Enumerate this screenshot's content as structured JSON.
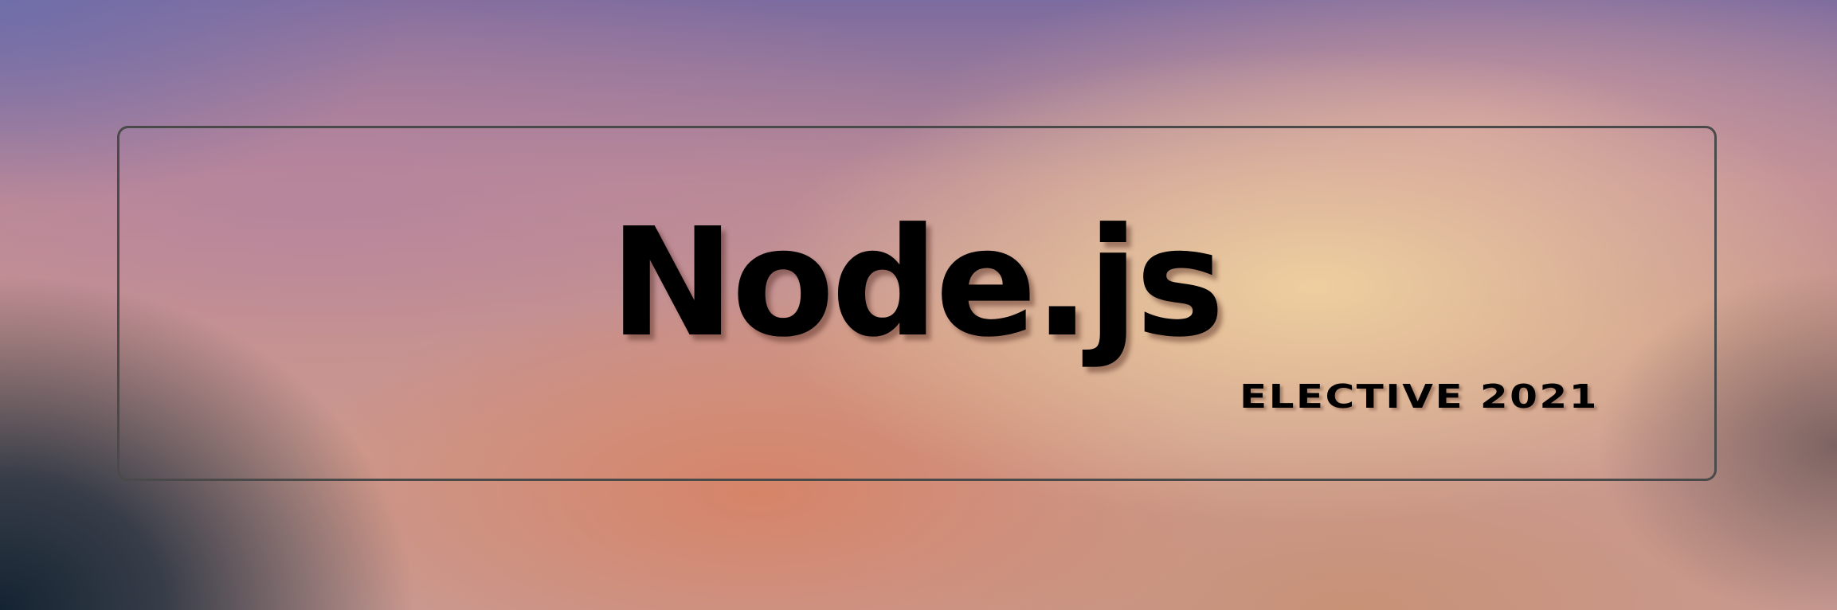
{
  "banner": {
    "title": "Node.js",
    "subtitle": "ELECTIVE 2021"
  },
  "colors": {
    "text": "#000000",
    "frame_border": "#4a4a4a",
    "gradient_top_left": "#7568a3",
    "gradient_center_right": "#efd1a2",
    "gradient_bottom_center": "#d27f63",
    "gradient_bottom_left": "#1e2b37"
  }
}
